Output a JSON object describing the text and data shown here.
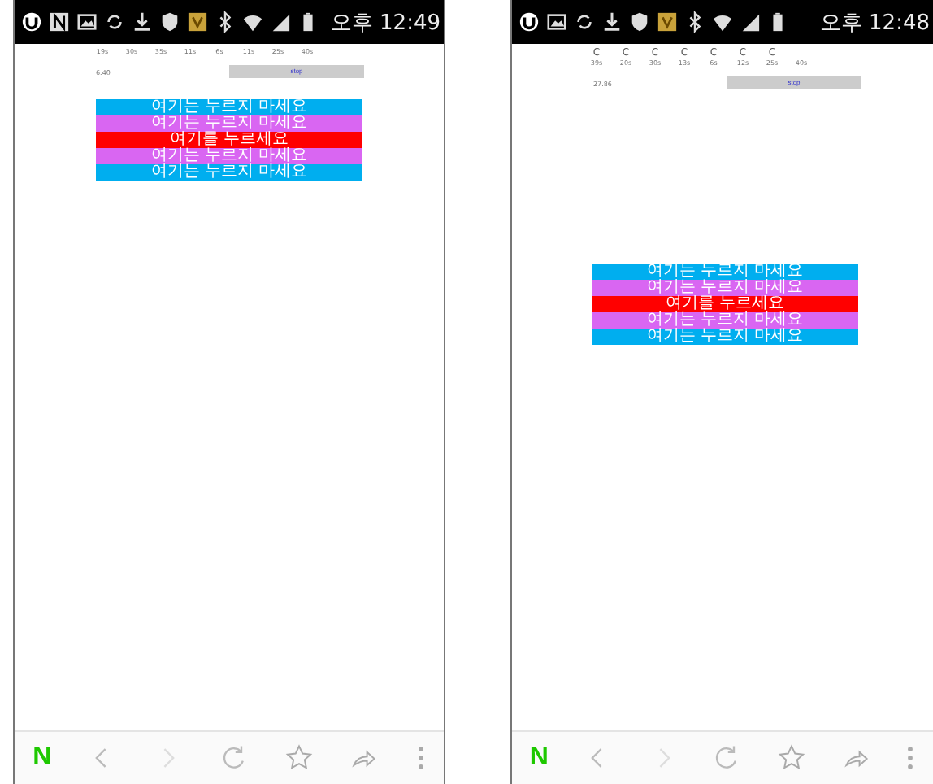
{
  "phones": [
    {
      "status_bar": {
        "icons": [
          {
            "kind": "u-logo"
          },
          {
            "kind": "n-box"
          },
          {
            "kind": "image"
          },
          {
            "kind": "sync"
          },
          {
            "kind": "download"
          },
          {
            "kind": "shield"
          },
          {
            "kind": "v-box"
          },
          {
            "kind": "bluetooth"
          },
          {
            "kind": "wifi"
          },
          {
            "kind": "signal"
          },
          {
            "kind": "battery"
          }
        ],
        "time": "오후 12:49"
      },
      "timers": [
        {
          "label": "19s"
        },
        {
          "label": "30s"
        },
        {
          "label": "35s"
        },
        {
          "label": "11s"
        },
        {
          "label": "6s"
        },
        {
          "label": "11s"
        },
        {
          "label": "25s"
        },
        {
          "label": "40s"
        }
      ],
      "value": "6.40",
      "button": "stop",
      "rows": [
        {
          "label": "여기는 누르지 마세요",
          "color": "#00aeef"
        },
        {
          "label": "여기는 누르지 마세요",
          "color": "#d966f2"
        },
        {
          "label": "여기를 누르세요",
          "color": "#ff0000"
        },
        {
          "label": "여기는 누르지 마세요",
          "color": "#d966f2"
        },
        {
          "label": "여기는 누르지 마세요",
          "color": "#00aeef"
        }
      ],
      "toolbar": {
        "logo": "N"
      }
    },
    {
      "status_bar": {
        "icons": [
          {
            "kind": "u-logo"
          },
          {
            "kind": "image"
          },
          {
            "kind": "sync"
          },
          {
            "kind": "download"
          },
          {
            "kind": "shield"
          },
          {
            "kind": "v-box"
          },
          {
            "kind": "bluetooth"
          },
          {
            "kind": "wifi"
          },
          {
            "kind": "signal"
          },
          {
            "kind": "battery"
          }
        ],
        "time": "오후 12:48"
      },
      "timers": [
        {
          "label": "39s",
          "note": "C"
        },
        {
          "label": "20s",
          "note": "C"
        },
        {
          "label": "30s",
          "note": "C"
        },
        {
          "label": "13s",
          "note": "C"
        },
        {
          "label": "6s",
          "note": "C"
        },
        {
          "label": "12s",
          "note": "C"
        },
        {
          "label": "25s",
          "note": "C"
        },
        {
          "label": "40s"
        }
      ],
      "value": "27.86",
      "button": "stop",
      "rows": [
        {
          "label": "여기는 누르지 마세요",
          "color": "#00aeef"
        },
        {
          "label": "여기는 누르지 마세요",
          "color": "#d966f2"
        },
        {
          "label": "여기를 누르세요",
          "color": "#ff0000"
        },
        {
          "label": "여기는 누르지 마세요",
          "color": "#d966f2"
        },
        {
          "label": "여기는 누르지 마세요",
          "color": "#00aeef"
        }
      ],
      "toolbar": {
        "logo": "N"
      }
    }
  ]
}
